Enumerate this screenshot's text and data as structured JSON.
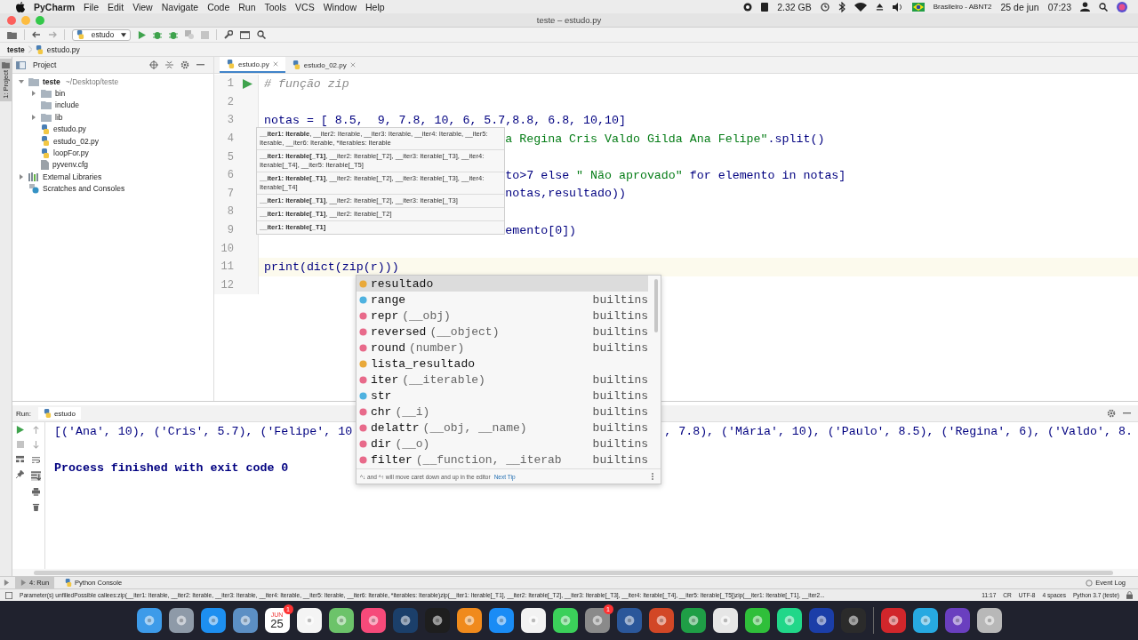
{
  "menubar": {
    "app": "PyCharm",
    "menus": [
      "File",
      "Edit",
      "View",
      "Navigate",
      "Code",
      "Run",
      "Tools",
      "VCS",
      "Window",
      "Help"
    ],
    "memory": "2.32 GB",
    "keyboard": "Brasileiro - ABNT2",
    "date": "25 de jun",
    "time": "07:23"
  },
  "window": {
    "title": "teste – estudo.py"
  },
  "toolbar": {
    "run_config": "estudo"
  },
  "breadcrumb": [
    "teste",
    "estudo.py"
  ],
  "left_strip": {
    "label": "1: Project"
  },
  "project_panel": {
    "title": "Project",
    "tree": [
      {
        "name": "teste",
        "path": "~/Desktop/teste",
        "kind": "root",
        "expandable": true,
        "expanded": true,
        "children": [
          {
            "name": "bin",
            "kind": "folder",
            "expandable": true,
            "expanded": false
          },
          {
            "name": "include",
            "kind": "folder",
            "expandable": false,
            "expanded": false
          },
          {
            "name": "lib",
            "kind": "folder",
            "expandable": true,
            "expanded": false
          },
          {
            "name": "estudo.py",
            "kind": "python",
            "expandable": false,
            "expanded": false
          },
          {
            "name": "estudo_02.py",
            "kind": "python",
            "expandable": false,
            "expanded": false
          },
          {
            "name": "loopFor.py",
            "kind": "python",
            "expandable": false,
            "expanded": false
          },
          {
            "name": "pyvenv.cfg",
            "kind": "text",
            "expandable": false,
            "expanded": false
          }
        ]
      },
      {
        "name": "External Libraries",
        "kind": "library",
        "expandable": true,
        "expanded": false
      },
      {
        "name": "Scratches and Consoles",
        "kind": "scratches",
        "expandable": false,
        "expanded": false
      }
    ]
  },
  "editor": {
    "tabs": [
      {
        "label": "estudo.py",
        "selected": true
      },
      {
        "label": "estudo_02.py",
        "selected": false
      }
    ],
    "lines": [
      {
        "number": "1",
        "run": true,
        "current": false,
        "kind": "full",
        "segments": [
          {
            "kind": "comment",
            "text": "# função zip"
          }
        ]
      },
      {
        "number": "2",
        "run": false,
        "current": false,
        "kind": "full"
      },
      {
        "number": "3",
        "run": false,
        "current": false,
        "kind": "full",
        "segments": [
          {
            "kind": "plain",
            "text": "notas = [ 8.5,  9, 7.8, 10, 6, 5.7,8.8, 6.8, 10,10]"
          }
        ]
      },
      {
        "number": "4",
        "run": false,
        "current": false,
        "kind": "partial",
        "segments": [
          {
            "kind": "string",
            "text": "a Regina Cris Valdo Gilda Ana Felipe\""
          },
          {
            "kind": "plain",
            "text": ".split()"
          }
        ]
      },
      {
        "number": "5",
        "run": false,
        "current": false,
        "kind": "full"
      },
      {
        "number": "6",
        "run": false,
        "current": false,
        "kind": "partial",
        "segments": [
          {
            "kind": "plain",
            "text": "to>7 else "
          },
          {
            "kind": "string",
            "text": "\" Não aprovado\""
          },
          {
            "kind": "plain",
            "text": " for elemento in notas]"
          }
        ]
      },
      {
        "number": "7",
        "run": false,
        "current": false,
        "kind": "partial",
        "segments": [
          {
            "kind": "plain",
            "text": "notas,resultado))"
          }
        ]
      },
      {
        "number": "8",
        "run": false,
        "current": false,
        "kind": "full"
      },
      {
        "number": "9",
        "run": false,
        "current": false,
        "kind": "partial",
        "segments": [
          {
            "kind": "plain",
            "text": "emento[0])"
          }
        ]
      },
      {
        "number": "10",
        "run": false,
        "current": false,
        "kind": "full"
      },
      {
        "number": "11",
        "run": false,
        "current": true,
        "kind": "full",
        "segments": [
          {
            "kind": "plain",
            "text": "print(dict(zip(r)))"
          }
        ]
      },
      {
        "number": "12",
        "run": false,
        "current": false,
        "kind": "full"
      }
    ]
  },
  "param_hints": [
    {
      "bold": "__iter1: Iterable",
      "rest": ", __iter2: Iterable, __iter3: Iterable, __iter4: Iterable, __iter5: Iterable, __iter6: Iterable, *iterables: Iterable"
    },
    {
      "bold": "__iter1: Iterable[_T1]",
      "rest": ", __iter2: Iterable[_T2], __iter3: Iterable[_T3], __iter4: Iterable[_T4], __iter5: Iterable[_T5]"
    },
    {
      "bold": "__iter1: Iterable[_T1]",
      "rest": ", __iter2: Iterable[_T2], __iter3: Iterable[_T3], __iter4: Iterable[_T4]"
    },
    {
      "bold": "__iter1: Iterable[_T1]",
      "rest": ", __iter2: Iterable[_T2], __iter3: Iterable[_T3]"
    },
    {
      "bold": "__iter1: Iterable[_T1]",
      "rest": ", __iter2: Iterable[_T2]"
    },
    {
      "bold": "__iter1: Iterable[_T1]"
    }
  ],
  "completion": {
    "items": [
      {
        "kind": "variable",
        "name": "resultado",
        "selected": true
      },
      {
        "kind": "class",
        "name": "range",
        "source": "builtins",
        "selected": false
      },
      {
        "kind": "function",
        "name": "repr",
        "params": "(__obj)",
        "source": "builtins",
        "selected": false
      },
      {
        "kind": "function",
        "name": "reversed",
        "params": "(__object)",
        "source": "builtins",
        "selected": false
      },
      {
        "kind": "function",
        "name": "round",
        "params": "(number)",
        "source": "builtins",
        "selected": false
      },
      {
        "kind": "variable",
        "name": "lista_resultado",
        "selected": false
      },
      {
        "kind": "function",
        "name": "iter",
        "params": "(__iterable)",
        "source": "builtins",
        "selected": false
      },
      {
        "kind": "class",
        "name": "str",
        "source": "builtins",
        "selected": false
      },
      {
        "kind": "function",
        "name": "chr",
        "params": "(__i)",
        "source": "builtins",
        "selected": false
      },
      {
        "kind": "function",
        "name": "delattr",
        "params": "(__obj, __name)",
        "source": "builtins",
        "selected": false
      },
      {
        "kind": "function",
        "name": "dir",
        "params": "(__o)",
        "source": "builtins",
        "selected": false
      },
      {
        "kind": "function",
        "name": "filter",
        "params": "(__function, __iterab",
        "source": "builtins",
        "selected": false
      }
    ],
    "footer": "^↓ and ^↑ will move caret down and up in the editor",
    "link": "Next Tip"
  },
  "run_panel": {
    "label": "Run:",
    "tab": "estudo",
    "output_left": "[('Ana', 10), ('Cris', 5.7), ('Felipe', 10",
    "output_right": ", 7.8), ('Mária', 10), ('Paulo', 8.5), ('Regina', 6), ('Valdo', 8.",
    "exit_message": "Process finished with exit code 0"
  },
  "bottom_tabs": [
    {
      "label": "4: Run",
      "selected": true
    },
    {
      "label": "Python Console",
      "selected": false
    }
  ],
  "event_log": "Event Log",
  "status_bar": {
    "message": "Parameter(s) unfilledPossible callees:zip(__iter1: Iterable, __iter2: Iterable, __iter3: Iterable, __iter4: Iterable, __iter5: Iterable, __iter6: Iterable, *iterables: Iterable)zip(__iter1: Iterable[_T1], __iter2: Iterable[_T2], __iter3: Iterable[_T3], __iter4: Iterable[_T4], __iter5: Iterable[_T5])zip(__iter1: Iterable[_T1], __iter2...",
    "position": "11:17",
    "line_separator": "CR",
    "encoding": "UTF-8",
    "indent": "4 spaces",
    "interpreter": "Python 3.7 (teste)"
  },
  "dock": [
    {
      "color": "#3d9be9"
    },
    {
      "color": "#8e9aa8"
    },
    {
      "color": "#1d8ff0"
    },
    {
      "color": "#5c8fc4"
    },
    {
      "color": "#ffffff",
      "month": "JUN",
      "day": "25",
      "badge": "1"
    },
    {
      "color": "#f4f4f4"
    },
    {
      "color": "#6cc36a"
    },
    {
      "color": "#f64a7a"
    },
    {
      "color": "#1b3f6a"
    },
    {
      "color": "#1e1e1e"
    },
    {
      "color": "#f08a1c"
    },
    {
      "color": "#1a8cf5"
    },
    {
      "color": "#f2f2f2"
    },
    {
      "color": "#3bd05a"
    },
    {
      "color": "#8a8a8a",
      "badge": "1"
    },
    {
      "color": "#2b579a"
    },
    {
      "color": "#d24726"
    },
    {
      "color": "#1f9e46"
    },
    {
      "color": "#e6e6e6"
    },
    {
      "color": "#2fbf3a"
    },
    {
      "color": "#21d789"
    },
    {
      "color": "#1b3ea8"
    },
    {
      "color": "#2b2b2b"
    },
    {
      "color": "#d1262b"
    },
    {
      "color": "#27a9e1"
    },
    {
      "color": "#6a3fbf"
    },
    {
      "color": "#b8b8b8"
    }
  ]
}
